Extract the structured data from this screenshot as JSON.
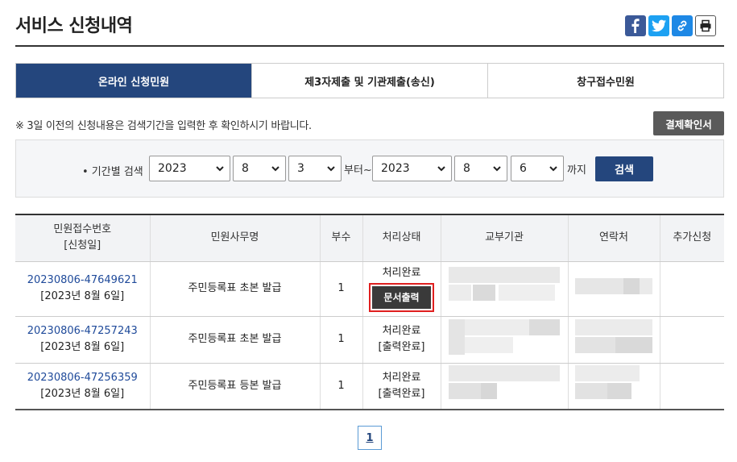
{
  "header": {
    "title": "서비스 신청내역"
  },
  "share": {
    "facebook_icon": "facebook-icon",
    "twitter_icon": "twitter-icon",
    "link_icon": "link-icon",
    "print_icon": "printer-icon"
  },
  "tabs": [
    {
      "label": "온라인 신청민원",
      "active": true
    },
    {
      "label": "제3자제출 및 기관제출(송신)",
      "active": false
    },
    {
      "label": "창구접수민원",
      "active": false
    }
  ],
  "notice": "※ 3일 이전의 신청내용은 검색기간을 입력한 후 확인하시기 바랍니다.",
  "receipt_button": "결제확인서",
  "search": {
    "label": "• 기간별 검색",
    "from_year": "2023",
    "from_month": "8",
    "from_day": "3",
    "from_suffix": "부터~",
    "to_year": "2023",
    "to_month": "8",
    "to_day": "6",
    "to_suffix": "까지",
    "button": "검색"
  },
  "table": {
    "headers": {
      "recv_line1": "민원접수번호",
      "recv_line2": "[신청일]",
      "name": "민원사무명",
      "copies": "부수",
      "status": "처리상태",
      "agency": "교부기관",
      "contact": "연락처",
      "extra": "추가신청"
    },
    "rows": [
      {
        "recv_no": "20230806-47649621",
        "date": "[2023년 8월 6일]",
        "name": "주민등록표 초본 발급",
        "copies": "1",
        "status": "처리완료",
        "status_action": "문서출력"
      },
      {
        "recv_no": "20230806-47257243",
        "date": "[2023년 8월 6일]",
        "name": "주민등록표 초본 발급",
        "copies": "1",
        "status": "처리완료",
        "status_sub": "[출력완료]"
      },
      {
        "recv_no": "20230806-47256359",
        "date": "[2023년 8월 6일]",
        "name": "주민등록표 등본 발급",
        "copies": "1",
        "status": "처리완료",
        "status_sub": "[출력완료]"
      }
    ]
  },
  "pagination": {
    "current": "1"
  }
}
